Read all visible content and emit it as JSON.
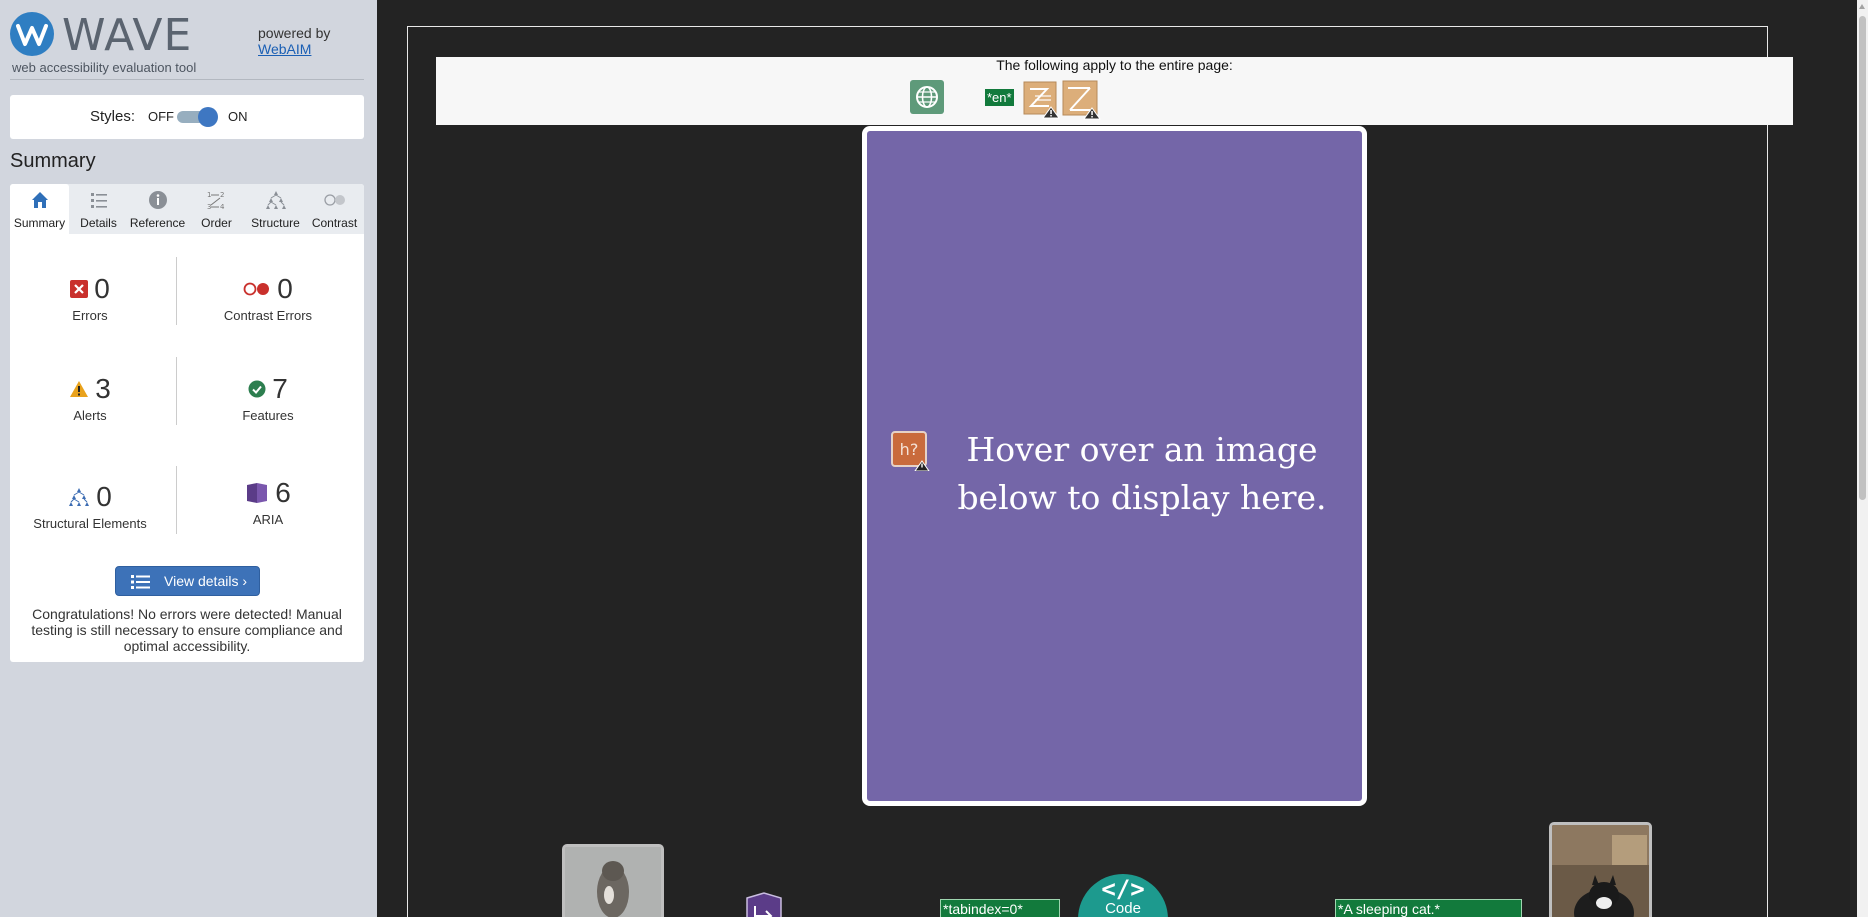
{
  "sidebar": {
    "logo_word": "WAVE",
    "logo_tagline": "web accessibility evaluation tool",
    "powered_by": "powered by",
    "webaim_link": "WebAIM",
    "styles": {
      "label": "Styles:",
      "off": "OFF",
      "on": "ON",
      "enabled": true
    },
    "summary_title": "Summary",
    "tabs": [
      {
        "label": "Summary",
        "icon": "home-icon",
        "active": true
      },
      {
        "label": "Details",
        "icon": "list-icon",
        "active": false
      },
      {
        "label": "Reference",
        "icon": "info-icon",
        "active": false
      },
      {
        "label": "Order",
        "icon": "order-icon",
        "active": false
      },
      {
        "label": "Structure",
        "icon": "structure-icon",
        "active": false
      },
      {
        "label": "Contrast",
        "icon": "contrast-icon",
        "active": false
      }
    ],
    "stats": {
      "errors": {
        "value": "0",
        "label": "Errors",
        "color": "#c9302c"
      },
      "contrast_errors": {
        "value": "0",
        "label": "Contrast Errors",
        "color": "#c9302c"
      },
      "alerts": {
        "value": "3",
        "label": "Alerts",
        "color": "#e9a21c"
      },
      "features": {
        "value": "7",
        "label": "Features",
        "color": "#2d7e4f"
      },
      "structural": {
        "value": "0",
        "label": "Structural Elements",
        "color": "#3d6db3"
      },
      "aria": {
        "value": "6",
        "label": "ARIA",
        "color": "#5b3c88"
      }
    },
    "view_details": "View details ›",
    "congrats": "Congratulations! No errors were detected! Manual testing is still necessary to ensure compliance and optimal accessibility."
  },
  "main": {
    "page_bar_text": "The following apply to the entire page:",
    "page_icons": [
      "language-icon",
      "lang-en-badge",
      "very-small-text-alert-icon",
      "justified-text-alert-icon"
    ],
    "lang_badge": "*en*",
    "hover_text": "Hover over an image below to display here.",
    "heading_alert_icon_text": "h?",
    "tabindex_label": "*tabindex=0*",
    "alt_label": "*A sleeping cat.*",
    "code_button": {
      "symbol": "</>",
      "label": "Code"
    }
  },
  "colors": {
    "accent": "#3d72b8",
    "sidebar_bg": "#d2d6de",
    "page_bg": "#232323",
    "hover_box": "#7466a8",
    "feature_green": "#127a3c",
    "code_teal": "#1d9a8e"
  }
}
